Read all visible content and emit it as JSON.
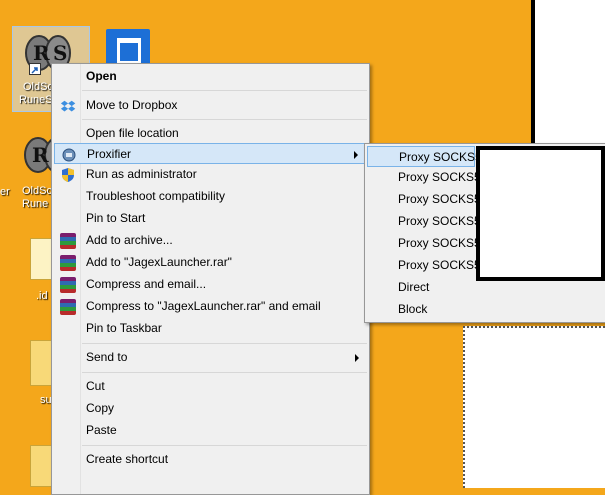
{
  "desktop": {
    "icons": [
      {
        "label_line1": "OldSc",
        "label_line2": "RuneS"
      },
      {
        "label_line1": "OldSc",
        "label_line2": "Rune"
      },
      {
        "label_line1": ".id"
      },
      {
        "label_line1": "su"
      }
    ],
    "edge_labels": [
      "er"
    ]
  },
  "context_menu": {
    "items": [
      {
        "label": "Open"
      },
      {
        "label": "Move to Dropbox"
      },
      {
        "label": "Open file location"
      },
      {
        "label": "Proxifier"
      },
      {
        "label": "Run as administrator"
      },
      {
        "label": "Troubleshoot compatibility"
      },
      {
        "label": "Pin to Start"
      },
      {
        "label": "Add to archive..."
      },
      {
        "label": "Add to \"JagexLauncher.rar\""
      },
      {
        "label": "Compress and email..."
      },
      {
        "label": "Compress to \"JagexLauncher.rar\" and email"
      },
      {
        "label": "Pin to Taskbar"
      },
      {
        "label": "Send to"
      },
      {
        "label": "Cut"
      },
      {
        "label": "Copy"
      },
      {
        "label": "Paste"
      },
      {
        "label": "Create shortcut"
      }
    ]
  },
  "proxifier_submenu": {
    "items": [
      {
        "label": "Proxy SOCKS5"
      },
      {
        "label": "Proxy SOCKS5"
      },
      {
        "label": "Proxy SOCKS5"
      },
      {
        "label": "Proxy SOCKS5"
      },
      {
        "label": "Proxy SOCKS5"
      },
      {
        "label": "Proxy SOCKS5"
      },
      {
        "label": "Direct"
      },
      {
        "label": "Block"
      }
    ]
  },
  "colors": {
    "desktop_bg": "#f4a71b",
    "menu_bg": "#f0f0f0",
    "highlight": "#d5e7f8",
    "highlight_border": "#7ab3e8"
  }
}
